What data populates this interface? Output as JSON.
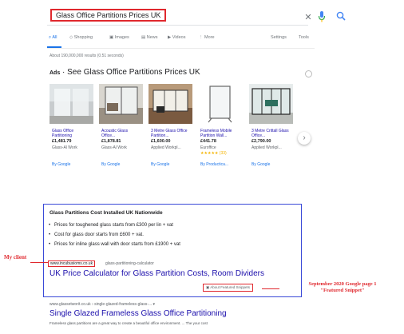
{
  "search": {
    "query": "Glass Office Partitions Prices UK",
    "clear_icon": "close-icon",
    "mic_icon": "microphone-icon",
    "search_icon": "search-icon"
  },
  "tabs": {
    "items": [
      {
        "label": "All",
        "active": true
      },
      {
        "label": "Shopping",
        "active": false
      },
      {
        "label": "Images",
        "active": false
      },
      {
        "label": "News",
        "active": false
      },
      {
        "label": "Videos",
        "active": false
      },
      {
        "label": "More",
        "active": false
      }
    ],
    "settings": "Settings",
    "tools": "Tools"
  },
  "result_stats": "About 190,000,000 results (0.51 seconds)",
  "ads": {
    "badge": "Ads",
    "title": "See Glass Office Partitions Prices UK",
    "cards": [
      {
        "title": "Glass Office Partitioning",
        "price": "£1,481.79",
        "store": "Glass-Al Work",
        "rating": "",
        "by": "By Google"
      },
      {
        "title": "Acoustic Glass Office...",
        "price": "£1,878.81",
        "store": "Glass-Al Work",
        "rating": "",
        "by": "By Google"
      },
      {
        "title": "3 Metre Glass Office Partition...",
        "price": "£1,600.00",
        "store": "Applied Workpl...",
        "rating": "",
        "by": "By Google"
      },
      {
        "title": "Frameless Mobile Partition Wall...",
        "price": "£441.78",
        "store": "Euroffice",
        "rating": "★★★★★ (33)",
        "by": "By Productica..."
      },
      {
        "title": "3 Metre Crittall Glass Office...",
        "price": "£2,790.00",
        "store": "Applied Workpl...",
        "rating": "",
        "by": "By Google"
      }
    ]
  },
  "snippet": {
    "heading": "Glass Partitions Cost Installed UK Nationwide",
    "bullets": [
      "Prices for toughened glass starts from £300 per lin + vat",
      "Cost for glass door starts from £600 + vat.",
      "Prices for inline glass wall with door starts from £1900 + vat"
    ],
    "url_domain": "www.incubusioms.co.uk",
    "url_path": "glass-partitioning-calculator",
    "title": "UK Price Calculator for Glass Partition Costs, Room Dividers",
    "featured_tag": "About Featured Snippets"
  },
  "annotations": {
    "client": "My client",
    "note_line1": "September 2020 Google page 1",
    "note_line2": "\"Featured Snippet\""
  },
  "result2": {
    "url": "www.glassetworit.co.uk › single-glazed-frameless-glass-... ▾",
    "title": "Single Glazed Frameless Glass Office Partitioning",
    "desc": "Frameless glass partitions are a great way to create a beautiful office environment. ... The your cost"
  }
}
